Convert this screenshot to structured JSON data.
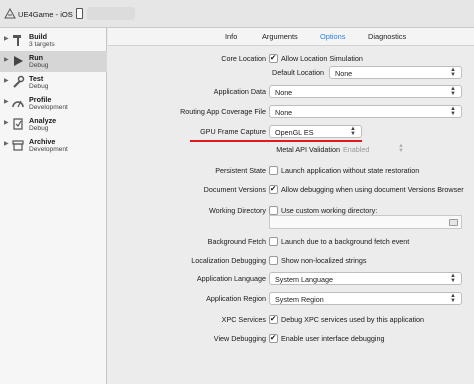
{
  "toolbar": {
    "scheme": "UE4Game - iOS",
    "separator": "›"
  },
  "sidebar": {
    "items": [
      {
        "title": "Build",
        "subtitle": "3 targets",
        "icon": "hammer-icon"
      },
      {
        "title": "Run",
        "subtitle": "Debug",
        "icon": "play-icon"
      },
      {
        "title": "Test",
        "subtitle": "Debug",
        "icon": "wrench-icon"
      },
      {
        "title": "Profile",
        "subtitle": "Development",
        "icon": "gauge-icon"
      },
      {
        "title": "Analyze",
        "subtitle": "Debug",
        "icon": "analyze-icon"
      },
      {
        "title": "Archive",
        "subtitle": "Development",
        "icon": "archive-icon"
      }
    ]
  },
  "tabs": [
    "Info",
    "Arguments",
    "Options",
    "Diagnostics"
  ],
  "options": {
    "core_location": {
      "label": "Core Location",
      "checkbox": "Allow Location Simulation",
      "checked": true
    },
    "default_location": {
      "label": "Default Location",
      "value": "None"
    },
    "application_data": {
      "label": "Application Data",
      "value": "None"
    },
    "routing": {
      "label": "Routing App Coverage File",
      "value": "None"
    },
    "gpu": {
      "label": "GPU Frame Capture",
      "value": "OpenGL ES"
    },
    "metal": {
      "label": "Metal API Validation",
      "value": "Enabled"
    },
    "persistent": {
      "label": "Persistent State",
      "checkbox": "Launch application without state restoration",
      "checked": false
    },
    "doc_versions": {
      "label": "Document Versions",
      "checkbox": "Allow debugging when using document Versions Browser",
      "checked": true
    },
    "working_dir": {
      "label": "Working Directory",
      "checkbox": "Use custom working directory:",
      "checked": false
    },
    "bg_fetch": {
      "label": "Background Fetch",
      "checkbox": "Launch due to a background fetch event",
      "checked": false
    },
    "localization": {
      "label": "Localization Debugging",
      "checkbox": "Show non-localized strings",
      "checked": false
    },
    "app_language": {
      "label": "Application Language",
      "value": "System Language"
    },
    "app_region": {
      "label": "Application Region",
      "value": "System Region"
    },
    "xpc": {
      "label": "XPC Services",
      "checkbox": "Debug XPC services used by this application",
      "checked": true
    },
    "view_debug": {
      "label": "View Debugging",
      "checkbox": "Enable user interface debugging",
      "checked": true
    }
  },
  "colors": {
    "accent": "#2a7ee6",
    "annotation": "#e01b1b"
  }
}
